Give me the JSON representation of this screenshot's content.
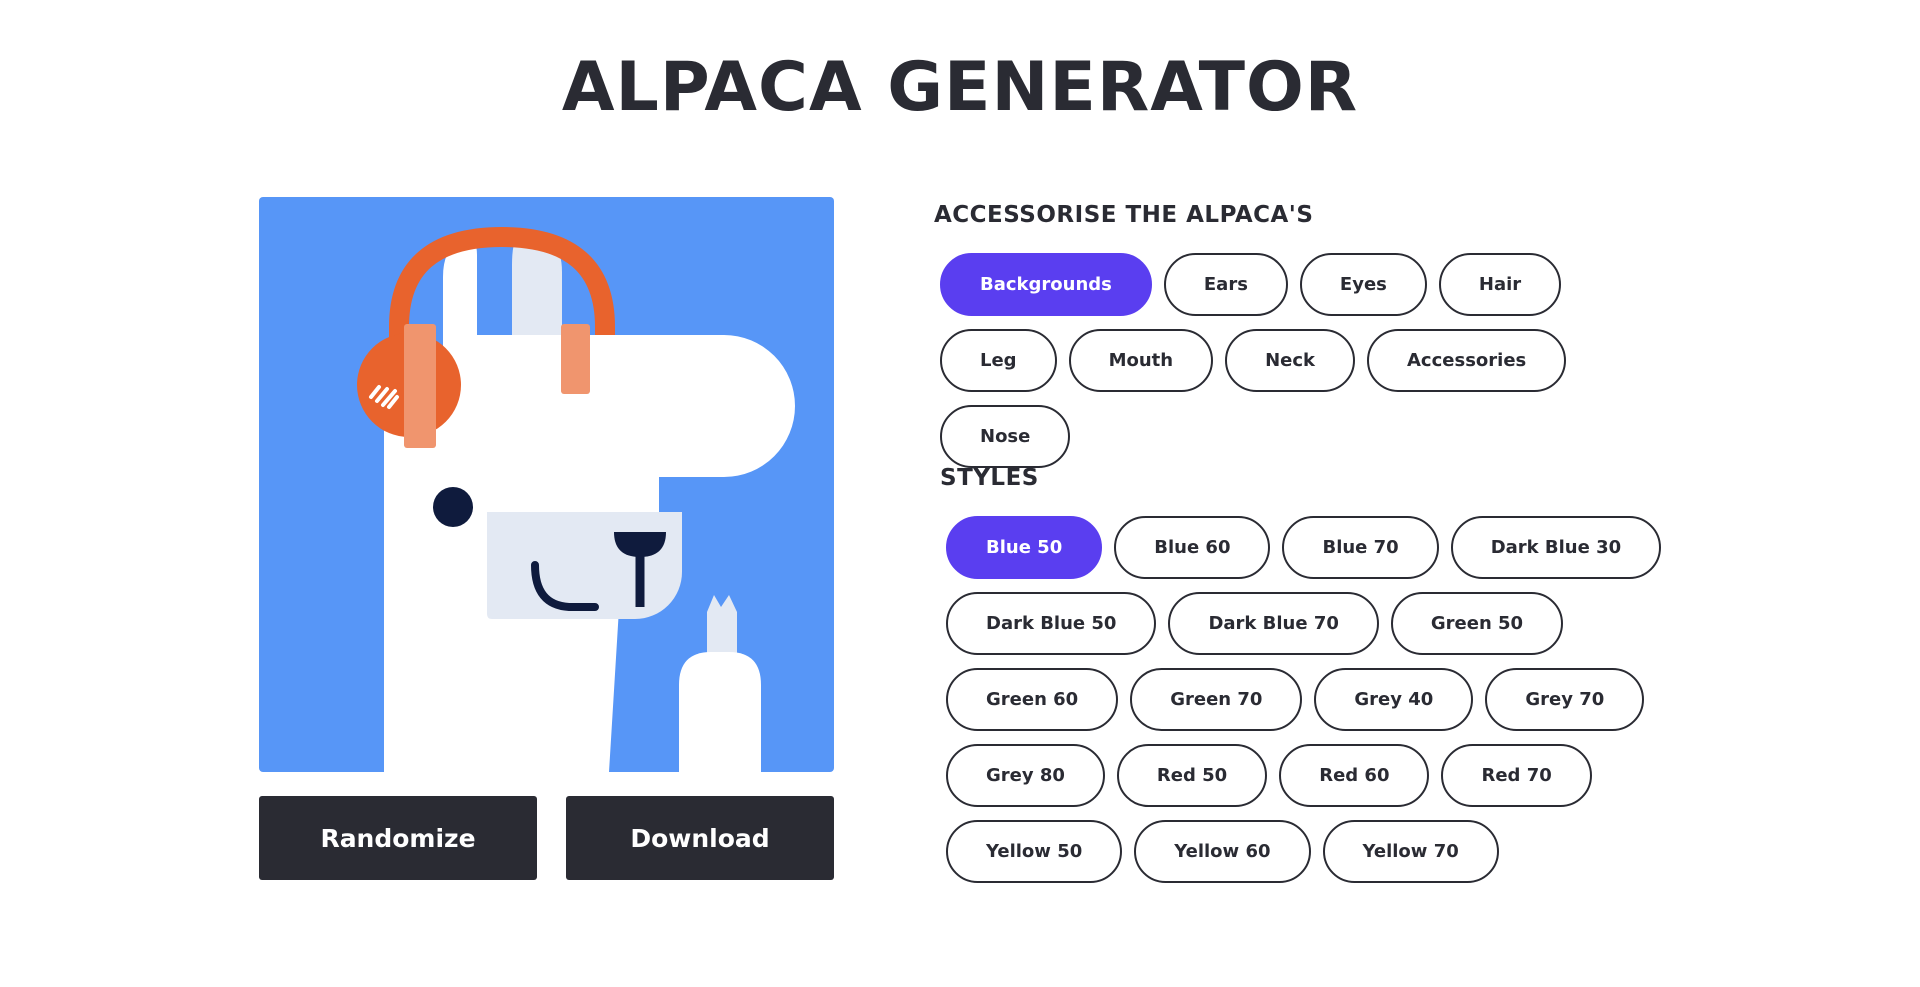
{
  "title": "ALPACA GENERATOR",
  "preview": {
    "background_color": "#5796f7",
    "headphone_color": "#e8632d",
    "cushion_color": "#f0956e",
    "body_color": "#ffffff",
    "muzzle_color": "#e3e9f3",
    "eye_color": "#0f1b3d"
  },
  "buttons": {
    "randomize": "Randomize",
    "download": "Download"
  },
  "accessorise": {
    "heading": "ACCESSORISE THE ALPACA'S",
    "items": [
      "Backgrounds",
      "Ears",
      "Eyes",
      "Hair",
      "Leg",
      "Mouth",
      "Neck",
      "Accessories",
      "Nose"
    ],
    "active": "Backgrounds"
  },
  "styles": {
    "heading": "STYLES",
    "items": [
      "Blue 50",
      "Blue 60",
      "Blue 70",
      "Dark Blue 30",
      "Dark Blue 50",
      "Dark Blue 70",
      "Green 50",
      "Green 60",
      "Green 70",
      "Grey 40",
      "Grey 70",
      "Grey 80",
      "Red 50",
      "Red 60",
      "Red 70",
      "Yellow 50",
      "Yellow 60",
      "Yellow 70"
    ],
    "active": "Blue 50"
  },
  "accent_color": "#5a3ef0",
  "dark_color": "#2a2b33"
}
